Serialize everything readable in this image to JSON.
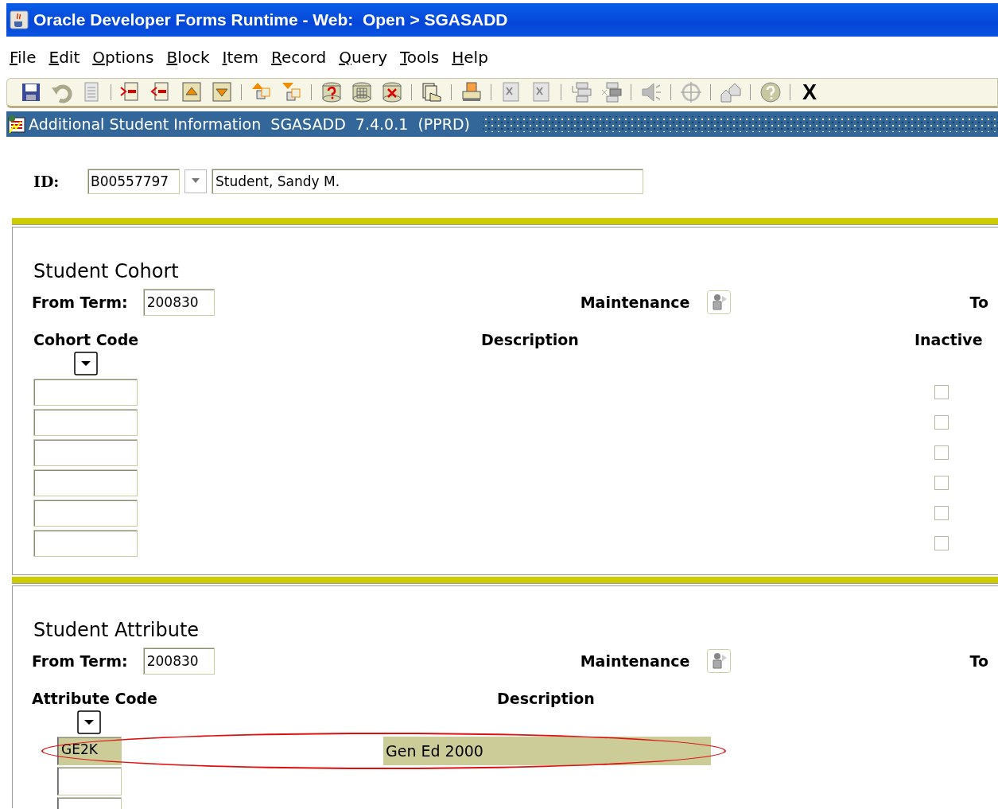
{
  "window": {
    "title": "Oracle Developer Forms Runtime - Web:  Open > SGASADD"
  },
  "menu": [
    "File",
    "Edit",
    "Options",
    "Block",
    "Item",
    "Record",
    "Query",
    "Tools",
    "Help"
  ],
  "toolbar": {
    "exit_label": "X"
  },
  "form_title": "Additional Student Information  SGASADD  7.4.0.1  (PPRD)",
  "key_block": {
    "label": "ID:",
    "id": "B00557797",
    "name": "Student, Sandy M."
  },
  "cohort": {
    "title": "Student Cohort",
    "from_term_label": "From Term:",
    "from_term": "200830",
    "maintenance_label": "Maintenance",
    "to_label": "To",
    "columns": [
      "Cohort Code",
      "Description",
      "Inactive"
    ],
    "rows": [
      {
        "inactive": false
      },
      {
        "inactive": false
      },
      {
        "inactive": false
      },
      {
        "inactive": false
      },
      {
        "inactive": false
      },
      {
        "inactive": false
      }
    ]
  },
  "attribute": {
    "title": "Student Attribute",
    "from_term_label": "From Term:",
    "from_term": "200830",
    "maintenance_label": "Maintenance",
    "to_label": "To",
    "columns": [
      "Attribute Code",
      "Description"
    ],
    "rows": [
      {
        "code": "GE2K",
        "description": "Gen Ed 2000",
        "selected": true,
        "circled": true
      },
      {
        "selected": false,
        "circled": false
      },
      {
        "selected": false,
        "circled": false
      }
    ]
  }
}
